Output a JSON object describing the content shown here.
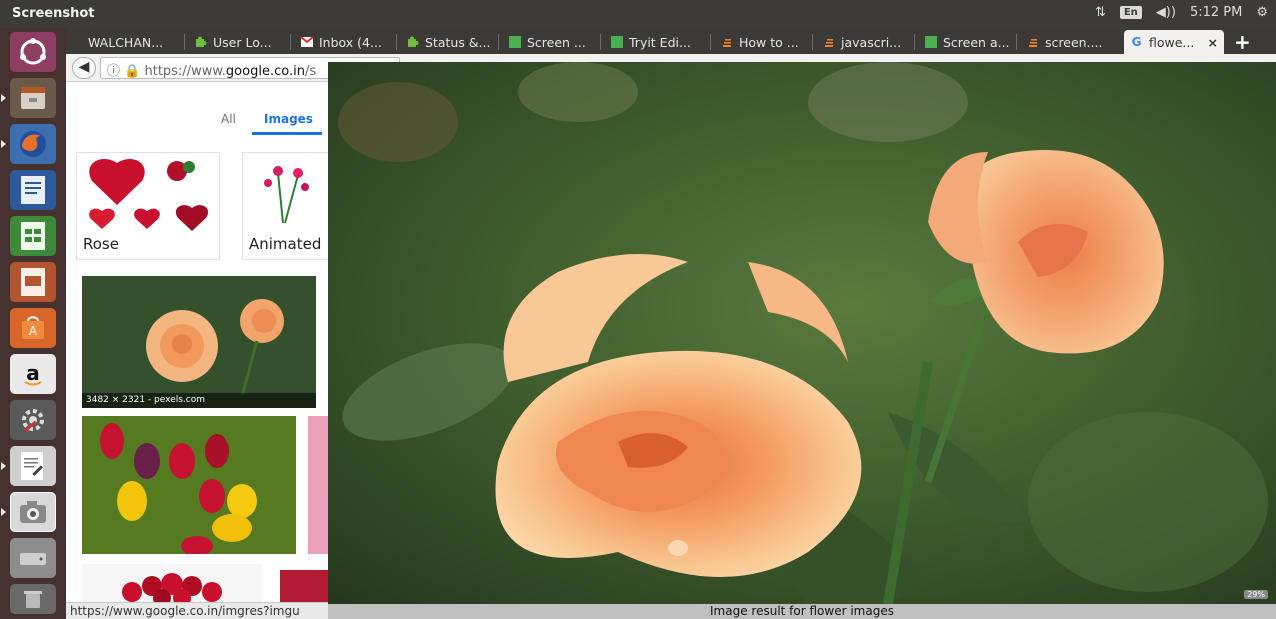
{
  "top_panel": {
    "title": "Screenshot",
    "lang": "En",
    "time": "5:12 PM"
  },
  "browser": {
    "tabs": [
      {
        "label": "WALCHAN...",
        "icon": "none"
      },
      {
        "label": "User Lo...",
        "icon": "puzzle-icon"
      },
      {
        "label": "Inbox (4...",
        "icon": "gmail-icon"
      },
      {
        "label": "Status &...",
        "icon": "puzzle-icon"
      },
      {
        "label": "Screen ...",
        "icon": "w3-icon"
      },
      {
        "label": "Tryit Edi...",
        "icon": "w3-icon"
      },
      {
        "label": "How to ...",
        "icon": "stackoverflow-icon"
      },
      {
        "label": "javascri...",
        "icon": "stackoverflow-icon"
      },
      {
        "label": "Screen a...",
        "icon": "w3-icon"
      },
      {
        "label": "screen....",
        "icon": "stackoverflow-icon"
      },
      {
        "label": "flowe...",
        "icon": "google-icon",
        "active": true
      }
    ],
    "close_tab": "×",
    "new_tab": "+",
    "url_prefix": "https://www.",
    "url_host": "google.co.in",
    "url_suffix": "/s"
  },
  "page": {
    "tab_all": "All",
    "tab_images": "Images",
    "chip_rose": "Rose",
    "chip_animated": "Animated",
    "thumb_caption": "3482 × 2321 - pexels.com"
  },
  "status_url": "https://www.google.co.in/imgres?imgu",
  "viewer": {
    "caption": "Image result for flower images",
    "zoom": "29%"
  },
  "colors": {
    "panel": "#3c3b37",
    "launcher": "#45312e",
    "accent": "#1a73e8"
  }
}
